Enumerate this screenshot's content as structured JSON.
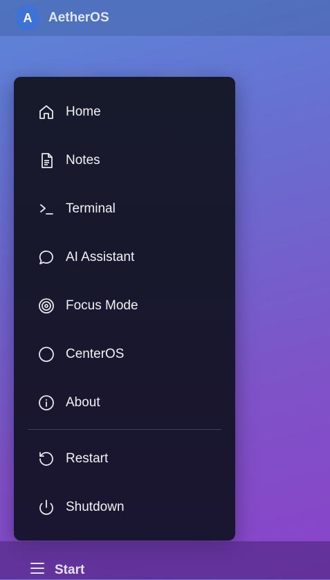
{
  "topbar": {
    "avatar_letter": "A",
    "title": "AetherOS"
  },
  "menu": {
    "items": [
      {
        "label": "Home",
        "icon": "home-icon"
      },
      {
        "label": "Notes",
        "icon": "notes-icon"
      },
      {
        "label": "Terminal",
        "icon": "terminal-icon"
      },
      {
        "label": "AI Assistant",
        "icon": "chat-icon"
      },
      {
        "label": "Focus Mode",
        "icon": "target-icon"
      },
      {
        "label": "CenterOS",
        "icon": "circle-icon"
      },
      {
        "label": "About",
        "icon": "info-icon"
      }
    ],
    "power": [
      {
        "label": "Restart",
        "icon": "restart-icon"
      },
      {
        "label": "Shutdown",
        "icon": "power-icon"
      }
    ]
  },
  "taskbar": {
    "start_label": "Start",
    "start_icon": "menu-icon"
  },
  "colors": {
    "accent": "#3f72d6",
    "menu_bg": "#171a2b"
  }
}
